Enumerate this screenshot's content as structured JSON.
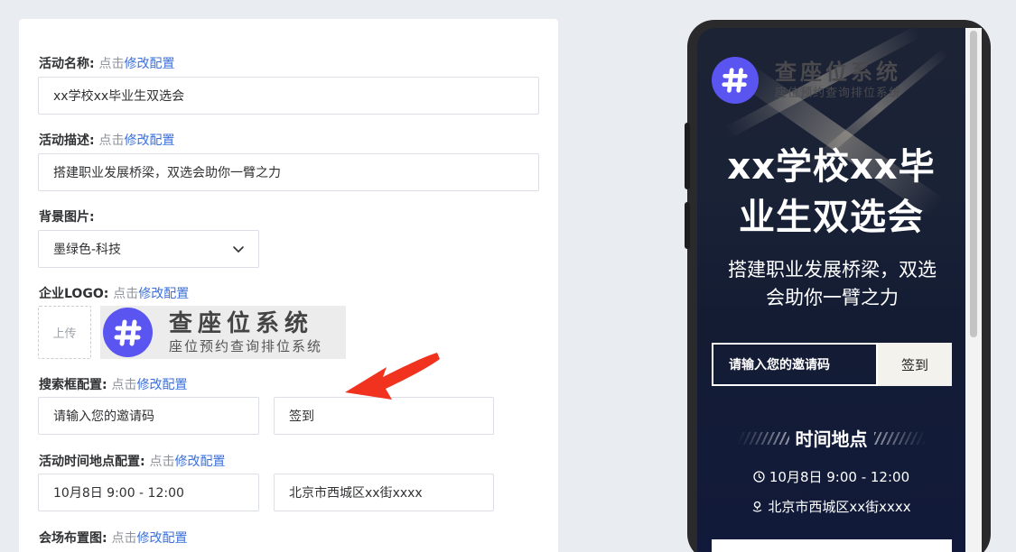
{
  "config": {
    "name_label": "活动名称:",
    "desc_label": "活动描述:",
    "bg_label": "背景图片:",
    "logo_label": "企业LOGO:",
    "search_label": "搜索框配置:",
    "timeplace_label": "活动时间地点配置:",
    "venue_label": "会场布置图:",
    "click_hint": "点击",
    "modify_link": "修改配置",
    "name_value": "xx学校xx毕业生双选会",
    "desc_value": "搭建职业发展桥梁，双选会助你一臂之力",
    "bg_selected": "墨绿色-科技",
    "upload_label": "上传",
    "logo_title": "查座位系统",
    "logo_subtitle": "座位预约查询排位系统",
    "search_placeholder_value": "请输入您的邀请码",
    "search_button_value": "签到",
    "time_value": "10月8日  9:00 - 12:00",
    "place_value": "北京市西城区xx街xxxx"
  },
  "preview": {
    "logo_title": "查座位系统",
    "logo_subtitle": "座位预约查询排位系统",
    "title_line1": "xx学校xx毕",
    "title_line2": "业生双选会",
    "desc_line1": "搭建职业发展桥梁，双选",
    "desc_line2": "会助你一臂之力",
    "search_placeholder": "请输入您的邀请码",
    "search_button": "签到",
    "section_title": "时间地点",
    "time": "10月8日  9:00 - 12:00",
    "place": "北京市西城区xx街xxxx"
  },
  "colors": {
    "link": "#3b6fd8",
    "logo_purple": "#5a55f0",
    "arrow_red": "#f0321e",
    "preview_bg": "#141c34"
  },
  "icons": [
    "chevron-down-icon",
    "hash-logo-icon",
    "clock-icon",
    "location-icon",
    "red-arrow-icon"
  ]
}
